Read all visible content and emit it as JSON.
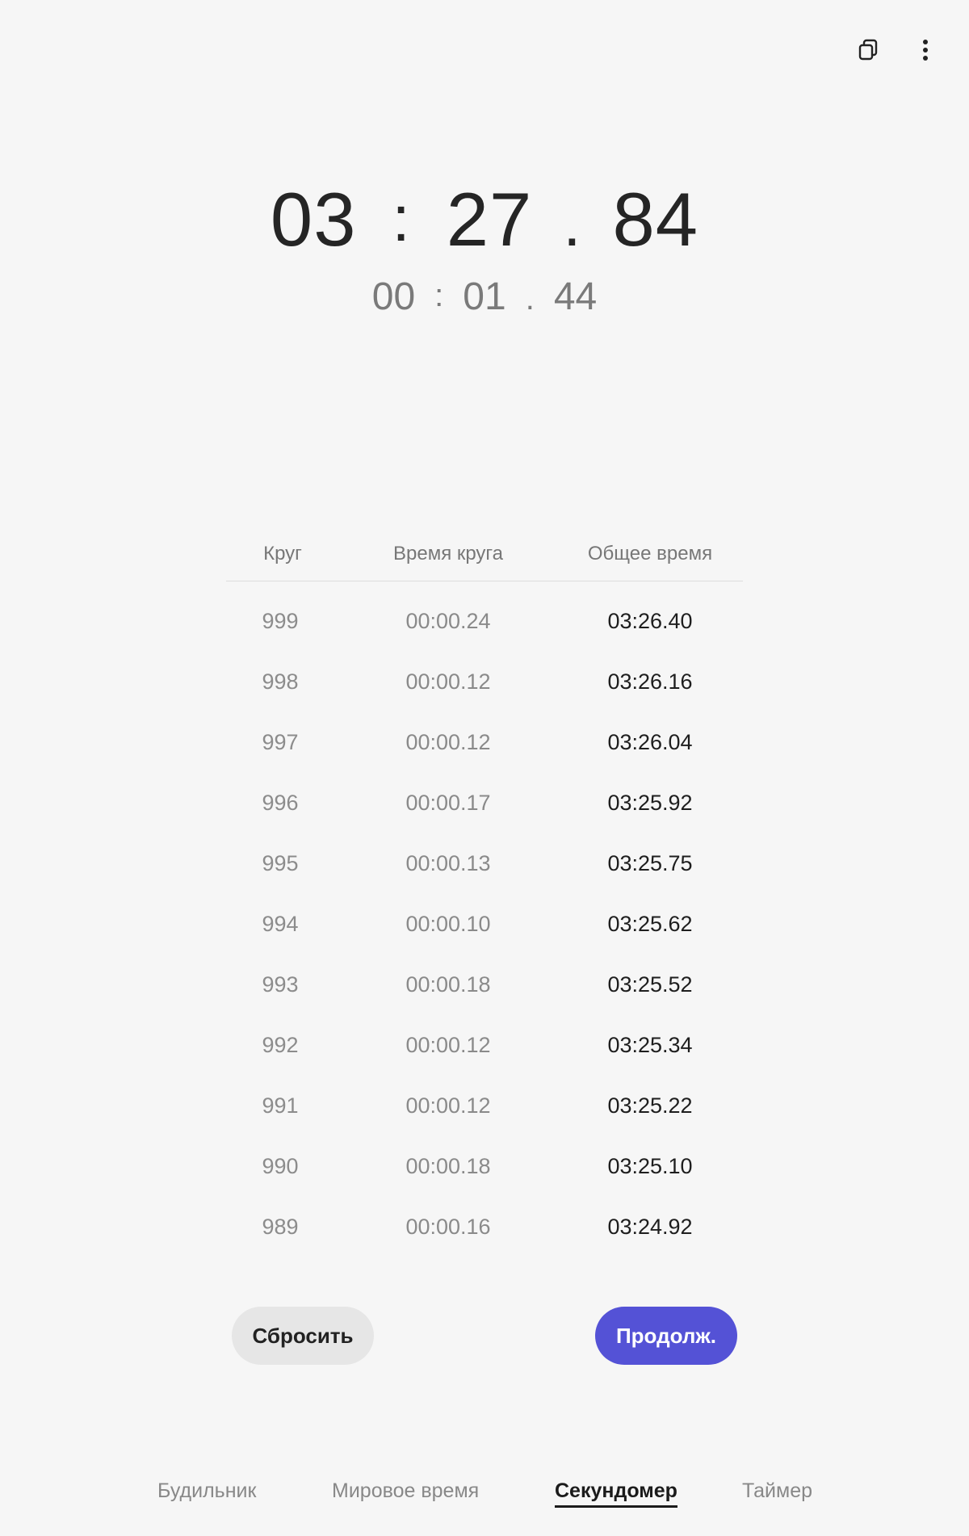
{
  "header": {
    "icons": [
      "layers-icon",
      "more-vert-icon"
    ]
  },
  "timer": {
    "main": {
      "minutes": "03",
      "seconds": "27",
      "hundredths": "84",
      "sep": ":",
      "dot": "."
    },
    "lap": {
      "minutes": "00",
      "seconds": "01",
      "hundredths": "44",
      "sep": ":",
      "dot": "."
    }
  },
  "laps": {
    "headers": {
      "lap": "Круг",
      "lap_time": "Время круга",
      "total_time": "Общее время"
    },
    "rows": [
      {
        "num": "999",
        "lap": "00:00.24",
        "total": "03:26.40"
      },
      {
        "num": "998",
        "lap": "00:00.12",
        "total": "03:26.16"
      },
      {
        "num": "997",
        "lap": "00:00.12",
        "total": "03:26.04"
      },
      {
        "num": "996",
        "lap": "00:00.17",
        "total": "03:25.92"
      },
      {
        "num": "995",
        "lap": "00:00.13",
        "total": "03:25.75"
      },
      {
        "num": "994",
        "lap": "00:00.10",
        "total": "03:25.62"
      },
      {
        "num": "993",
        "lap": "00:00.18",
        "total": "03:25.52"
      },
      {
        "num": "992",
        "lap": "00:00.12",
        "total": "03:25.34"
      },
      {
        "num": "991",
        "lap": "00:00.12",
        "total": "03:25.22"
      },
      {
        "num": "990",
        "lap": "00:00.18",
        "total": "03:25.10"
      },
      {
        "num": "989",
        "lap": "00:00.16",
        "total": "03:24.92"
      }
    ]
  },
  "buttons": {
    "reset": "Сбросить",
    "resume": "Продолж."
  },
  "tabs": {
    "alarm": "Будильник",
    "world_clock": "Мировое время",
    "stopwatch": "Секундомер",
    "timer": "Таймер"
  },
  "colors": {
    "accent": "#5452d6",
    "background": "#f6f6f6"
  }
}
